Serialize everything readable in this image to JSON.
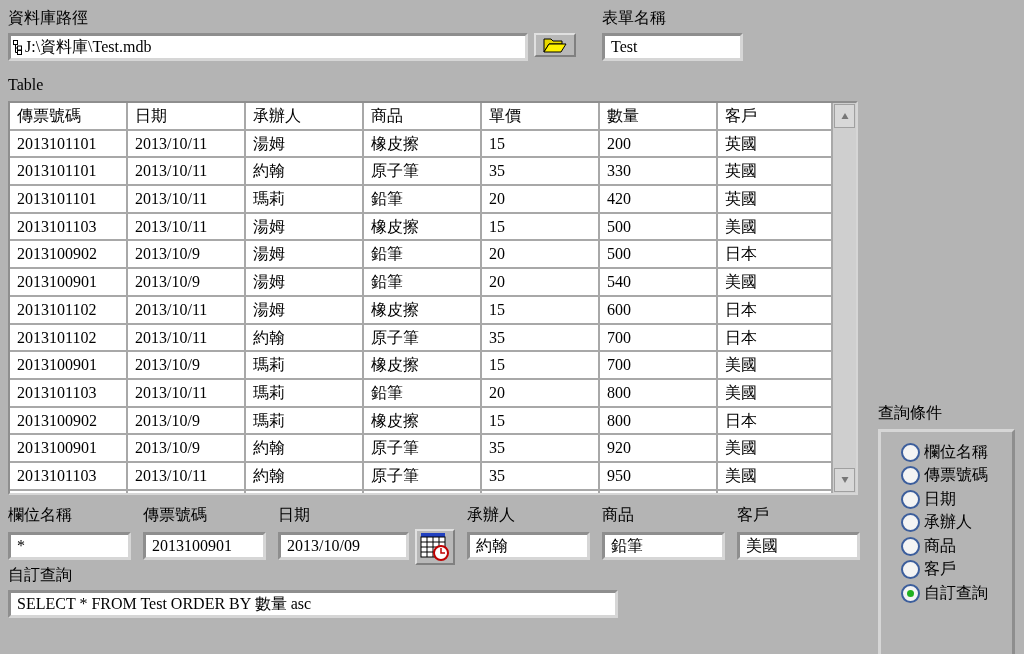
{
  "database_path": {
    "label": "資料庫路徑",
    "value": "J:\\資料庫\\Test.mdb"
  },
  "form_name": {
    "label": "表單名稱",
    "value": "Test"
  },
  "table": {
    "label": "Table",
    "columns": [
      "傳票號碼",
      "日期",
      "承辦人",
      "商品",
      "單價",
      "數量",
      "客戶"
    ],
    "rows": [
      [
        "2013101101",
        "2013/10/11",
        "湯姆",
        "橡皮擦",
        "15",
        "200",
        "英國"
      ],
      [
        "2013101101",
        "2013/10/11",
        "約翰",
        "原子筆",
        "35",
        "330",
        "英國"
      ],
      [
        "2013101101",
        "2013/10/11",
        "瑪莉",
        "鉛筆",
        "20",
        "420",
        "英國"
      ],
      [
        "2013101103",
        "2013/10/11",
        "湯姆",
        "橡皮擦",
        "15",
        "500",
        "美國"
      ],
      [
        "2013100902",
        "2013/10/9",
        "湯姆",
        "鉛筆",
        "20",
        "500",
        "日本"
      ],
      [
        "2013100901",
        "2013/10/9",
        "湯姆",
        "鉛筆",
        "20",
        "540",
        "美國"
      ],
      [
        "2013101102",
        "2013/10/11",
        "湯姆",
        "橡皮擦",
        "15",
        "600",
        "日本"
      ],
      [
        "2013101102",
        "2013/10/11",
        "約翰",
        "原子筆",
        "35",
        "700",
        "日本"
      ],
      [
        "2013100901",
        "2013/10/9",
        "瑪莉",
        "橡皮擦",
        "15",
        "700",
        "美國"
      ],
      [
        "2013101103",
        "2013/10/11",
        "瑪莉",
        "鉛筆",
        "20",
        "800",
        "美國"
      ],
      [
        "2013100902",
        "2013/10/9",
        "瑪莉",
        "橡皮擦",
        "15",
        "800",
        "日本"
      ],
      [
        "2013100901",
        "2013/10/9",
        "約翰",
        "原子筆",
        "35",
        "920",
        "美國"
      ],
      [
        "2013101103",
        "2013/10/11",
        "約翰",
        "原子筆",
        "35",
        "950",
        "美國"
      ]
    ]
  },
  "filters": [
    {
      "kind": "text",
      "label": "欄位名稱",
      "value": "*"
    },
    {
      "kind": "text",
      "label": "傳票號碼",
      "value": "2013100901"
    },
    {
      "kind": "date",
      "label": "日期",
      "value": "2013/10/09"
    },
    {
      "kind": "text",
      "label": "承辦人",
      "value": "約翰"
    },
    {
      "kind": "text",
      "label": "商品",
      "value": "鉛筆"
    },
    {
      "kind": "text",
      "label": "客戶",
      "value": "美國"
    }
  ],
  "custom_query": {
    "label": "自訂查詢",
    "value": "SELECT * FROM Test ORDER BY 數量 asc"
  },
  "query_conditions": {
    "label": "查詢條件",
    "options": [
      {
        "label": "欄位名稱",
        "selected": false
      },
      {
        "label": "傳票號碼",
        "selected": false
      },
      {
        "label": "日期",
        "selected": false
      },
      {
        "label": "承辦人",
        "selected": false
      },
      {
        "label": "商品",
        "selected": false
      },
      {
        "label": "客戶",
        "selected": false
      },
      {
        "label": "自訂查詢",
        "selected": true
      }
    ]
  }
}
